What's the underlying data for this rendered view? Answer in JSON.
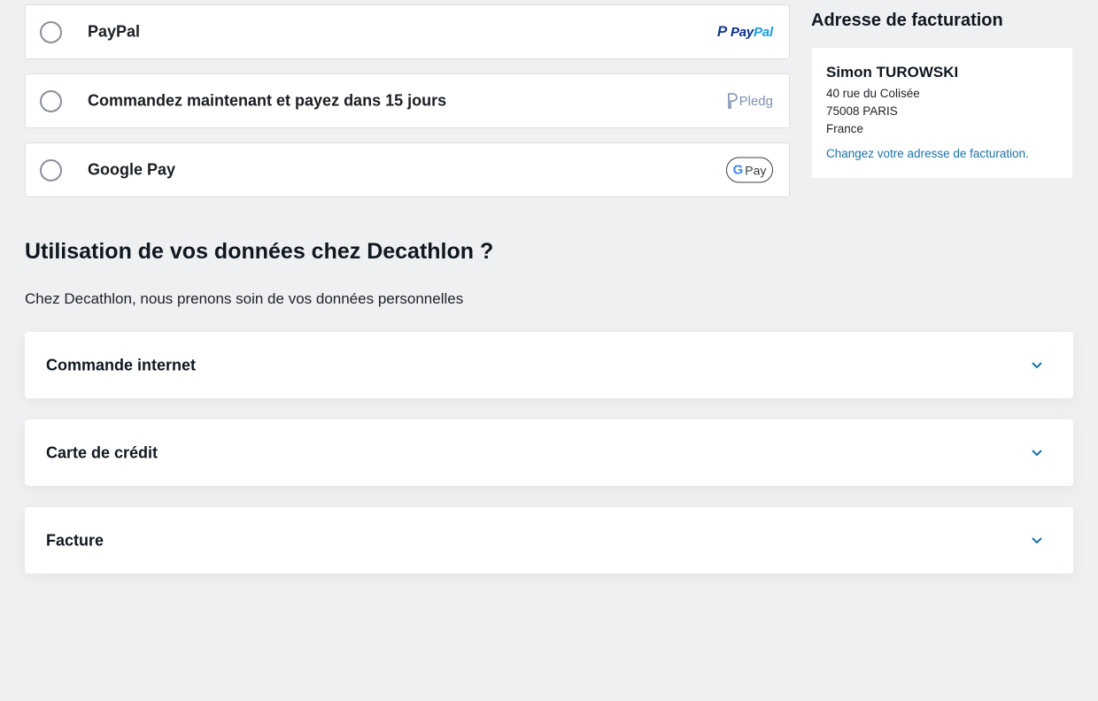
{
  "payment_options": [
    {
      "label": "PayPal",
      "logo": "paypal-logo"
    },
    {
      "label": "Commandez maintenant et payez dans 15 jours",
      "logo": "pledg-logo"
    },
    {
      "label": "Google Pay",
      "logo": "google-pay-logo"
    }
  ],
  "logos": {
    "paypal_pay": "Pay",
    "paypal_pal": "Pal",
    "pledg": "Pledg",
    "gpay_g": "G",
    "gpay_pay": "Pay"
  },
  "billing": {
    "title": "Adresse de facturation",
    "name": "Simon TUROWSKI",
    "street": "40 rue du Colisée",
    "city": "75008 PARIS",
    "country": "France",
    "change_link": "Changez votre adresse de facturation."
  },
  "data_section": {
    "title": "Utilisation de vos données chez Decathlon ?",
    "subtitle": "Chez Decathlon, nous prenons soin de vos données personnelles",
    "accordions": [
      {
        "label": "Commande internet"
      },
      {
        "label": "Carte de crédit"
      },
      {
        "label": "Facture"
      }
    ]
  },
  "colors": {
    "background": "#eff0f2",
    "link": "#1a73a8",
    "chevron": "#1a73a8"
  }
}
